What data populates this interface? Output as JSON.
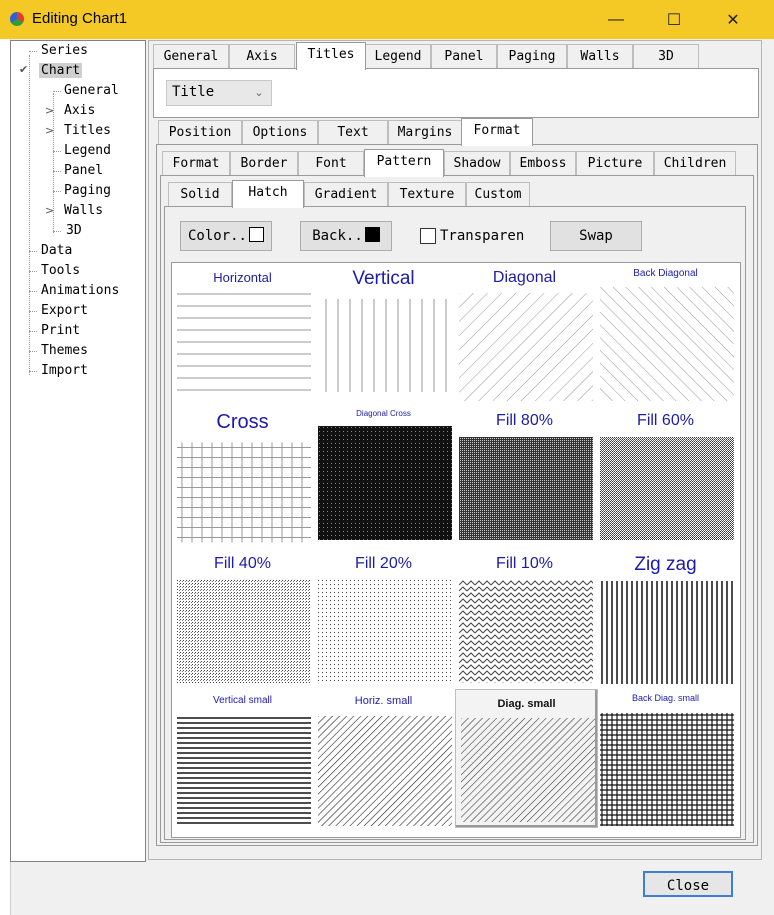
{
  "window": {
    "title": "Editing Chart1"
  },
  "tree": [
    {
      "label": "Series",
      "key": "series"
    },
    {
      "label": "Chart",
      "key": "chart"
    },
    {
      "label": "General",
      "key": "general"
    },
    {
      "label": "Axis",
      "key": "axis"
    },
    {
      "label": "Titles",
      "key": "titles"
    },
    {
      "label": "Legend",
      "key": "legend"
    },
    {
      "label": "Panel",
      "key": "panel"
    },
    {
      "label": "Paging",
      "key": "paging"
    },
    {
      "label": "Walls",
      "key": "walls"
    },
    {
      "label": "3D",
      "key": "3d"
    },
    {
      "label": "Data",
      "key": "data"
    },
    {
      "label": "Tools",
      "key": "tools"
    },
    {
      "label": "Animations",
      "key": "animations"
    },
    {
      "label": "Export",
      "key": "export"
    },
    {
      "label": "Print",
      "key": "print"
    },
    {
      "label": "Themes",
      "key": "themes"
    },
    {
      "label": "Import",
      "key": "import"
    }
  ],
  "tabs_main": [
    "General",
    "Axis",
    "Titles",
    "Legend",
    "Panel",
    "Paging",
    "Walls",
    "3D"
  ],
  "title_select": {
    "value": "Title"
  },
  "tabs_title": [
    "Position",
    "Options",
    "Text",
    "Margins",
    "Format"
  ],
  "tabs_format": [
    "Format",
    "Border",
    "Font",
    "Pattern",
    "Shadow",
    "Emboss",
    "Picture",
    "Children"
  ],
  "tabs_pattern": [
    "Solid",
    "Hatch",
    "Gradient",
    "Texture",
    "Custom"
  ],
  "hatch_controls": {
    "color_label": "Color..",
    "back_label": "Back..",
    "transparent_label": "Transparen",
    "swap_label": "Swap"
  },
  "hatches": [
    "Horizontal",
    "Vertical",
    "Diagonal",
    "Back Diagonal",
    "Cross",
    "Diagonal Cross",
    "Fill 80%",
    "Fill 60%",
    "Fill 40%",
    "Fill 20%",
    "Fill 10%",
    "Zig zag",
    "Vertical small",
    "Horiz. small",
    "Diag. small",
    "Back Diag. small"
  ],
  "footer": {
    "close_label": "Close"
  },
  "colors": {
    "titlebar": "#f5c925",
    "hatch_label": "#1c1ca8",
    "close_border": "#3c7fd4"
  }
}
